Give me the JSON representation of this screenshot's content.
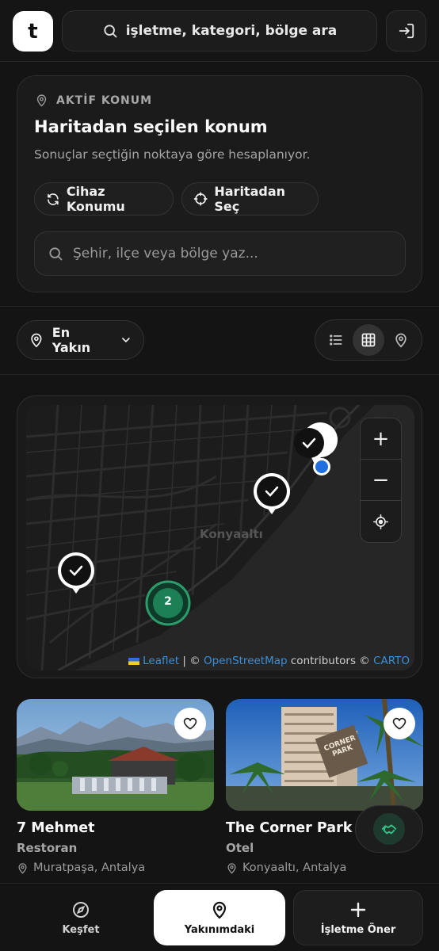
{
  "header": {
    "logo_letter": "t",
    "search_placeholder": "işletme, kategori, bölge ara"
  },
  "location": {
    "label": "AKTİF KONUM",
    "title": "Haritadan seçilen konum",
    "subtitle": "Sonuçlar seçtiğin noktaya göre hesaplanıyor.",
    "device_button": "Cihaz Konumu",
    "map_pick_button": "Haritadan Seç",
    "input_placeholder": "Şehir, ilçe veya bölge yaz..."
  },
  "sort": {
    "selected": "En Yakın"
  },
  "view_modes": {
    "active": "grid"
  },
  "map": {
    "district_label": "Konyaaltı",
    "cluster_count": "2",
    "zoom_in": "+",
    "zoom_out": "−",
    "attribution": {
      "leaflet": "Leaflet",
      "sep1": " | © ",
      "osm": "OpenStreetMap",
      "contributors": " contributors © ",
      "carto": "CARTO"
    }
  },
  "places": [
    {
      "name": "7 Mehmet",
      "category": "Restoran",
      "address": "Muratpaşa, Antalya"
    },
    {
      "name": "The Corner Park Ho",
      "category": "Otel",
      "address": "Konyaaltı, Antalya",
      "sign_text": "CORNER PARK"
    }
  ],
  "bottom_nav": {
    "discover": "Keşfet",
    "nearby": "Yakınımdaki",
    "suggest": "İşletme Öner"
  },
  "colors": {
    "accent_green": "#2a9d6b",
    "user_blue": "#1f6fe0",
    "link_blue": "#3a8fd8"
  }
}
